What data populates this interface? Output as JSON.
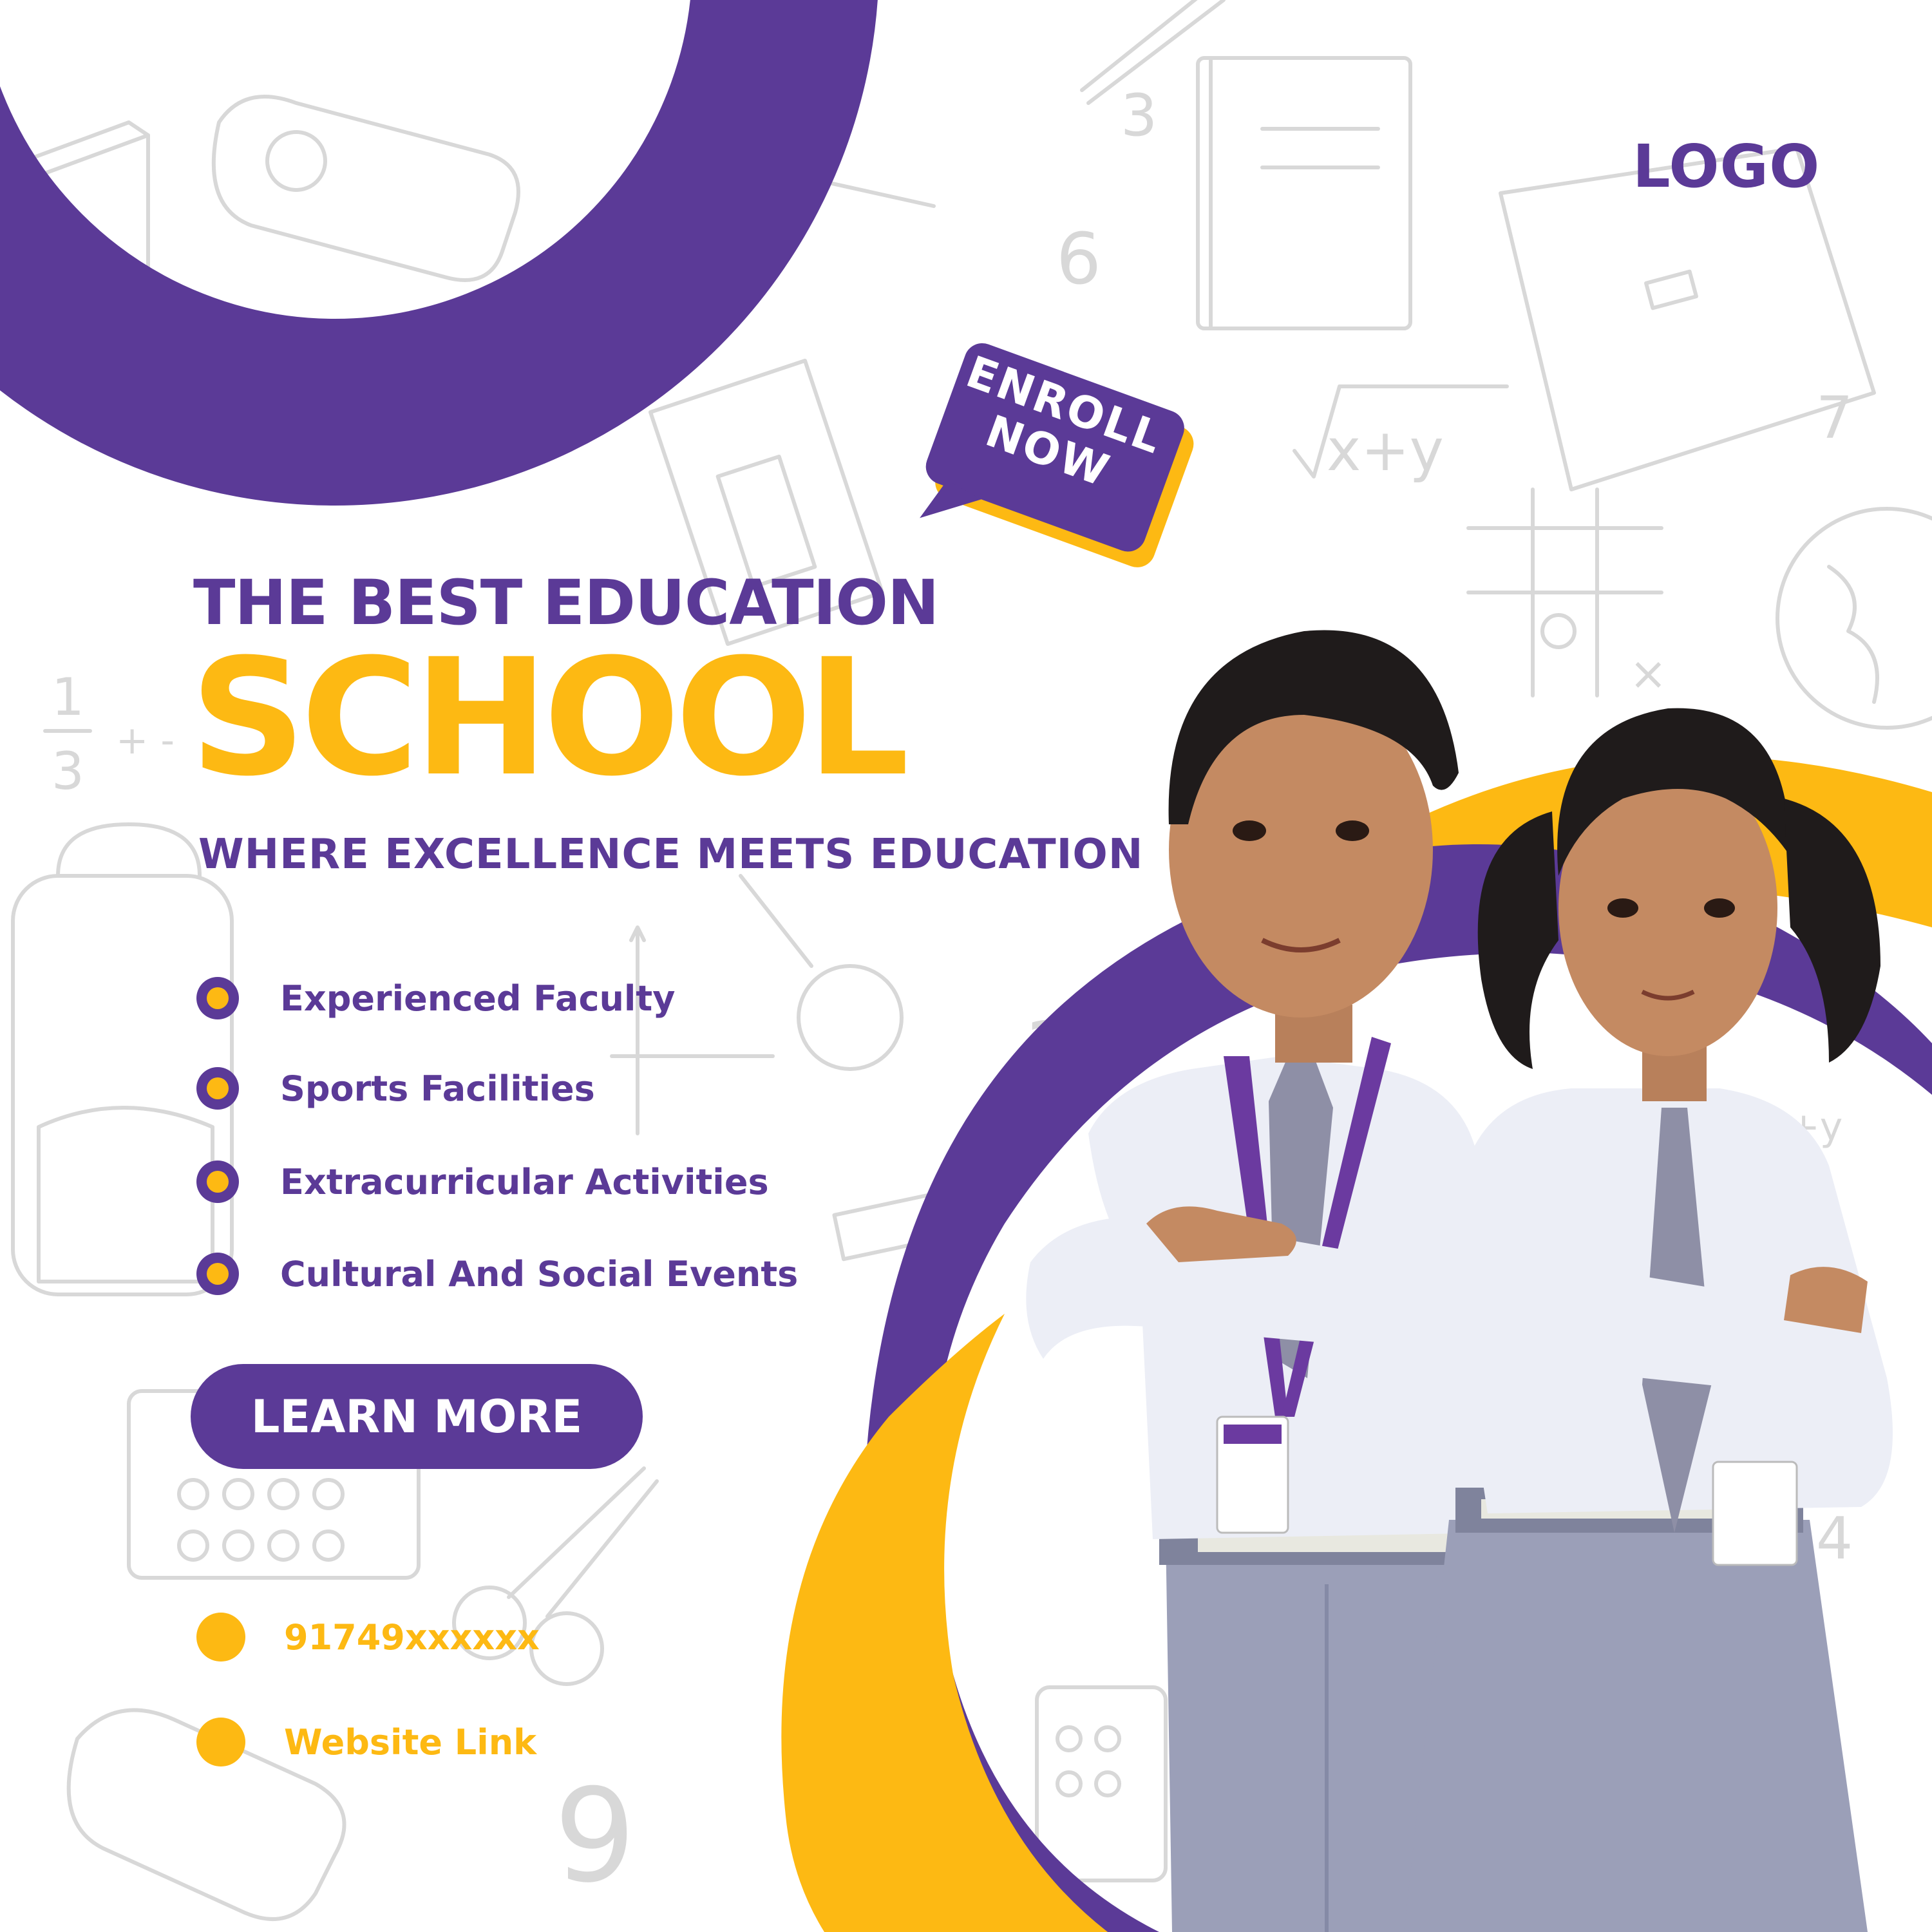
{
  "colors": {
    "purple": "#5b3a97",
    "yellow": "#fdb913",
    "doodle": "#d9d9d9",
    "background": "#ffffff"
  },
  "header": {
    "logo": "LOGO"
  },
  "badge": {
    "line1": "ENROLL",
    "line2": "NOW"
  },
  "hero": {
    "headline": "THE BEST EDUCATION",
    "title": "SCHOOL",
    "tagline": "WHERE EXCELLENCE MEETS EDUCATION"
  },
  "features": [
    {
      "label": "Experienced Faculty",
      "icon": "bullet-dot-icon"
    },
    {
      "label": "Sports Facilities",
      "icon": "bullet-dot-icon"
    },
    {
      "label": "Extracurricular Activities",
      "icon": "bullet-dot-icon"
    },
    {
      "label": "Cultural And Social Events",
      "icon": "bullet-dot-icon"
    }
  ],
  "cta": {
    "learn_more": "LEARN MORE"
  },
  "contact": {
    "phone": "91749xxxxxx",
    "website": "Website Link"
  },
  "photo": {
    "subject": "two-students-in-uniform"
  }
}
